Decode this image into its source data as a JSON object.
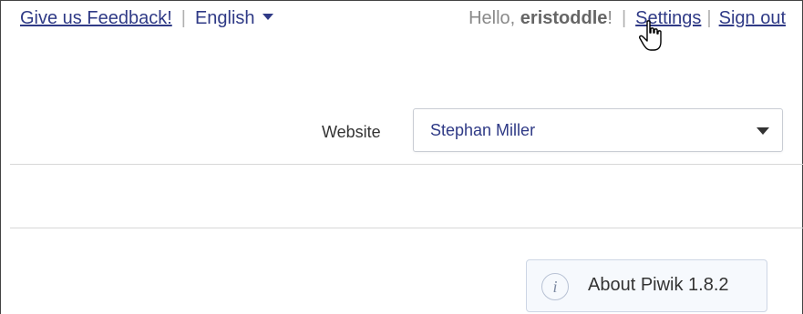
{
  "header": {
    "feedback_link": "Give us Feedback!",
    "separator": "|",
    "language": "English",
    "greeting_prefix": "Hello, ",
    "username": "eristoddle",
    "greeting_suffix": "!",
    "settings_link": "Settings",
    "signout_link": "Sign out"
  },
  "website_selector": {
    "label": "Website",
    "selected": "Stephan Miller"
  },
  "about": {
    "label": "About Piwik 1.8.2"
  },
  "colors": {
    "link": "#2f3a86",
    "muted": "#8a8a8a",
    "border": "#c9cdd4"
  }
}
